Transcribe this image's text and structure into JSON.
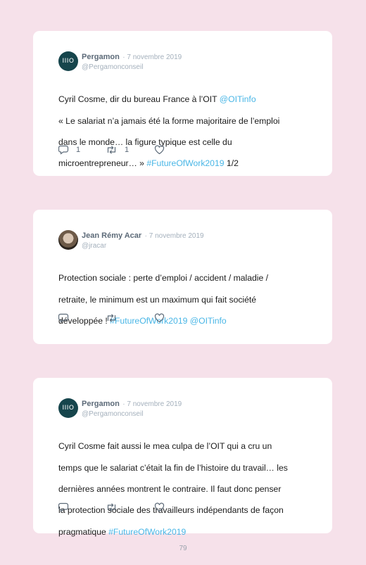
{
  "tweets": [
    {
      "name": "Pergamon",
      "date": "· 7 novembre 2019",
      "handle": "@Pergamonconseil",
      "avatar_text": "IIIO",
      "text_lines": [
        {
          "t": "Cyril Cosme, dir du bureau France à l’OIT ",
          "mention": "@OITinfo"
        },
        {
          "t": "« Le salariat n’a jamais été la forme majoritaire de l’emploi"
        },
        {
          "t": "dans le monde… la figure typique est celle du"
        },
        {
          "t": "microentrepreneur… » ",
          "hashtag": "#FutureOfWork2019",
          "after": " 1/2"
        }
      ],
      "reply_count": "1",
      "retweet_count": "1"
    },
    {
      "name": "Jean Rémy Acar",
      "date": "· 7 novembre 2019",
      "handle": "@jracar",
      "text_lines": [
        {
          "t": "Protection sociale : perte d’emploi / accident / maladie /"
        },
        {
          "t": "retraite, le minimum est un maximum qui fait société"
        },
        {
          "t": "développée ! ",
          "hashtag": "#FutureOfWork2019",
          "mention2": " @OITinfo"
        }
      ]
    },
    {
      "name": "Pergamon",
      "date": "· 7 novembre 2019",
      "handle": "@Pergamonconseil",
      "avatar_text": "IIIO",
      "text_lines": [
        {
          "t": "Cyril Cosme fait aussi le mea culpa de l’OIT qui a cru un"
        },
        {
          "t": "temps que le salariat c’était la fin de l’histoire du travail… les"
        },
        {
          "t": "dernières années montrent le contraire. Il faut donc penser"
        },
        {
          "t": "la protection sociale des travailleurs indépendants de façon"
        },
        {
          "t": "pragmatique ",
          "hashtag": "#FutureOfWork2019"
        }
      ]
    }
  ],
  "page_number": "79"
}
